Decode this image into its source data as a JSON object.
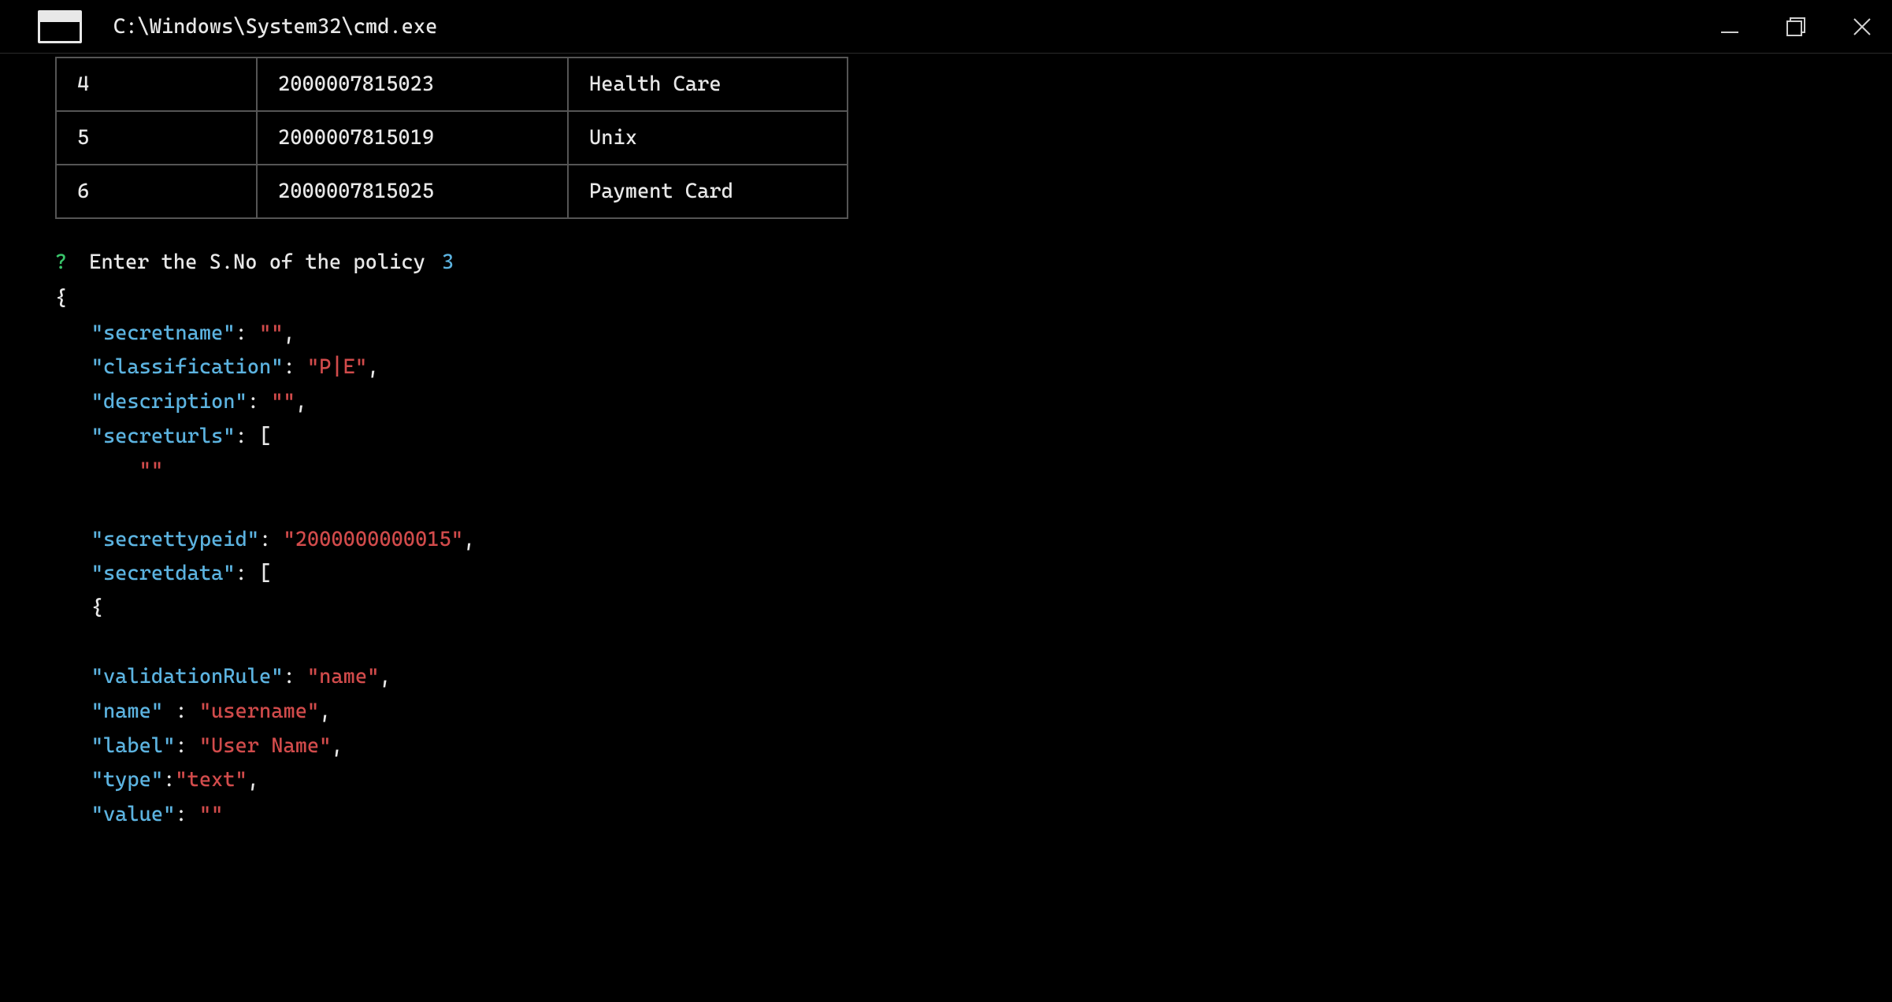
{
  "window": {
    "title": "C:\\Windows\\System32\\cmd.exe"
  },
  "table": {
    "rows": [
      {
        "sno": "4",
        "id": "2000007815023",
        "name": "Health Care"
      },
      {
        "sno": "5",
        "id": "2000007815019",
        "name": "Unix"
      },
      {
        "sno": "6",
        "id": "2000007815025",
        "name": "Payment Card"
      }
    ]
  },
  "prompt": {
    "marker": "?",
    "text": "Enter the S.No of the policy",
    "answer": "3"
  },
  "json": {
    "open": "{",
    "indent1": "   ",
    "indent2": "       ",
    "q": "\"",
    "comma": ",",
    "colon_sp": ": ",
    "colonns": ":",
    "colon_sp2": " : ",
    "lbracket": "[",
    "lblock": "{",
    "keys": {
      "secretname": "secretname",
      "classification": "classification",
      "description": "description",
      "secreturls": "secreturls",
      "secrettypeid": "secrettypeid",
      "secretdata": "secretdata",
      "validationRule": "validationRule",
      "name": "name",
      "label": "label",
      "type": "type",
      "value": "value"
    },
    "vals": {
      "empty": "",
      "classification": "P|E",
      "secrettypeid": "2000000000015",
      "validationRule": "name",
      "name": "username",
      "label": "User Name",
      "type": "text"
    }
  }
}
